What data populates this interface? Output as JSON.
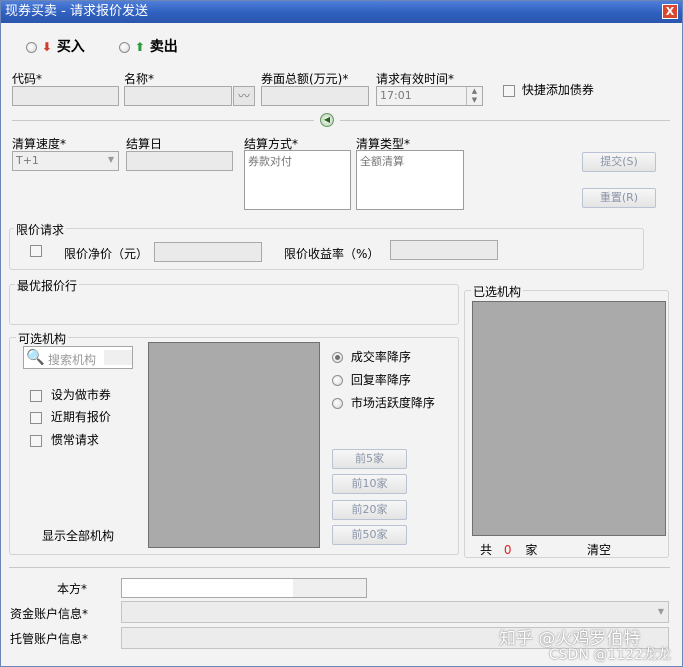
{
  "window": {
    "title": "现券买卖 - 请求报价发送",
    "close": "X"
  },
  "direction": {
    "buy": "买入",
    "sell": "卖出"
  },
  "top": {
    "code_label": "代码*",
    "name_label": "名称*",
    "face_label": "券面总额(万元)*",
    "valid_time_label": "请求有效时间*",
    "valid_time_value": "17:01",
    "quick_add_label": "快捷添加债券"
  },
  "settle": {
    "speed_label": "清算速度*",
    "speed_value": "T+1",
    "date_label": "结算日",
    "method_label": "结算方式*",
    "method_value": "券款对付",
    "type_label": "清算类型*",
    "type_value": "全额清算"
  },
  "buttons": {
    "submit": "提交(S)",
    "reset": "重置(R)"
  },
  "limit": {
    "title": "限价请求",
    "net_price_label": "限价净价（元）",
    "yield_label": "限价收益率（%）"
  },
  "best": {
    "title": "最优报价行"
  },
  "optional": {
    "title": "可选机构",
    "search_placeholder": "搜索机构",
    "options": [
      "设为做市券",
      "近期有报价",
      "惯常请求"
    ],
    "show_all": "显示全部机构",
    "sorts": [
      "成交率降序",
      "回复率降序",
      "市场活跃度降序"
    ],
    "top_buttons": [
      "前5家",
      "前10家",
      "前20家",
      "前50家"
    ]
  },
  "selected": {
    "title": "已选机构",
    "total_prefix": "共",
    "count": "0",
    "unit": "家",
    "clear": "清空"
  },
  "accounts": {
    "self_label": "本方*",
    "fund_label": "资金账户信息*",
    "custody_label": "托管账户信息*"
  },
  "watermark": {
    "line1": "知乎 @火鸡罗伯特",
    "line2": "CSDN @1122龙龙"
  },
  "colors": {
    "title_bar": "#2f5fbf",
    "count_red": "#e02020",
    "panel_gray": "#aaaaaa"
  }
}
